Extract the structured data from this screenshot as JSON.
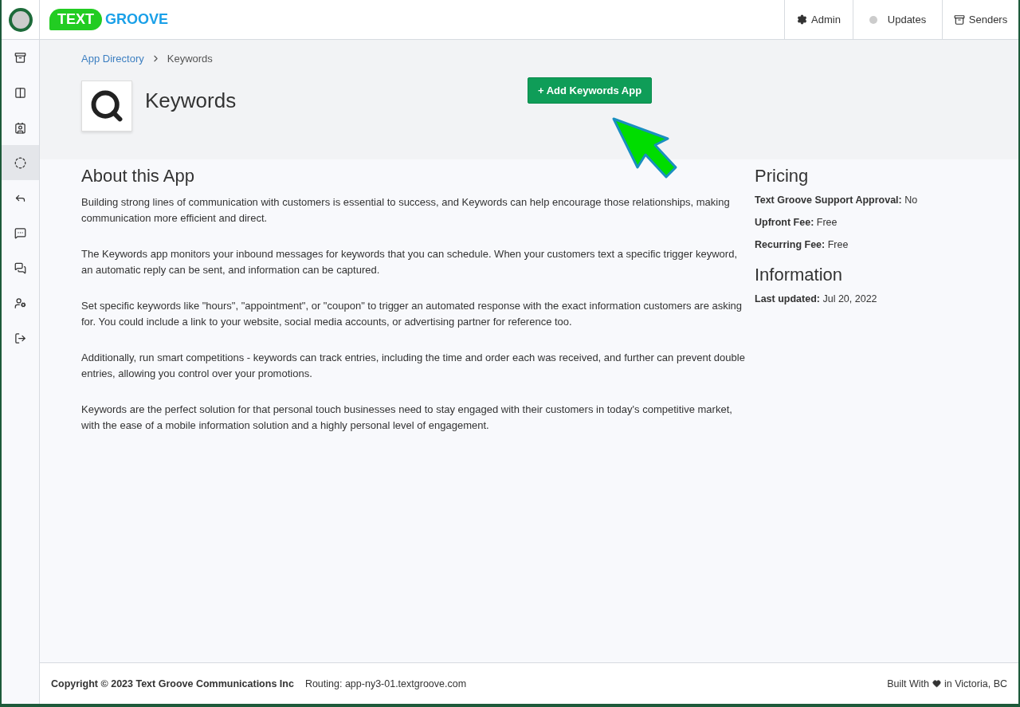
{
  "logo": {
    "badge": "TEXT",
    "word": "GROOVE"
  },
  "top_nav": [
    {
      "kind": "gear",
      "label": "Admin"
    },
    {
      "kind": "dot",
      "label": "Updates"
    },
    {
      "kind": "tray",
      "label": "Senders"
    }
  ],
  "sidebar": {
    "items": [
      {
        "selected": false
      },
      {
        "selected": false
      },
      {
        "selected": false
      },
      {
        "selected": true
      },
      {
        "selected": false
      },
      {
        "selected": false
      },
      {
        "selected": false
      },
      {
        "selected": false
      },
      {
        "selected": false
      }
    ]
  },
  "breadcrumb": [
    {
      "label": "App Directory",
      "link": true
    },
    {
      "label": "Keywords",
      "link": false
    }
  ],
  "app": {
    "title": "Keywords",
    "add_button": "+ Add Keywords App"
  },
  "about": {
    "heading": "About this App",
    "paragraphs": [
      "Building strong lines of communication with customers is essential to success, and Keywords can help encourage those relationships, making communication more efficient and direct.",
      "The Keywords app monitors your inbound messages for keywords that you can schedule. When your customers text a specific trigger keyword, an automatic reply can be sent, and information can be captured.",
      "Set specific keywords like \"hours\", \"appointment\", or \"coupon\" to trigger an automated response with the exact information customers are asking for. You could include a link to your website, social media accounts, or advertising partner for reference too.",
      "Additionally, run smart competitions - keywords can track entries, including the time and order each was received, and further can prevent double entries, allowing you control over your promotions.",
      "Keywords are the perfect solution for that personal touch businesses need to stay engaged with their customers in today's competitive market, with the ease of a mobile information solution and a highly personal level of engagement."
    ]
  },
  "pricing": {
    "heading": "Pricing",
    "rows": [
      {
        "label": "Text Groove Support Approval:",
        "value": "No"
      },
      {
        "label": "Upfront Fee:",
        "value": "Free"
      },
      {
        "label": "Recurring Fee:",
        "value": "Free"
      }
    ]
  },
  "information": {
    "heading": "Information",
    "rows": [
      {
        "label": "Last updated:",
        "value": "Jul 20, 2022"
      }
    ]
  },
  "footer": {
    "copyright": "Copyright © 2023 Text Groove Communications Inc",
    "routing": "Routing: app-ny3-01.textgroove.com",
    "built_with": "Built With",
    "location": "in Victoria, BC"
  }
}
